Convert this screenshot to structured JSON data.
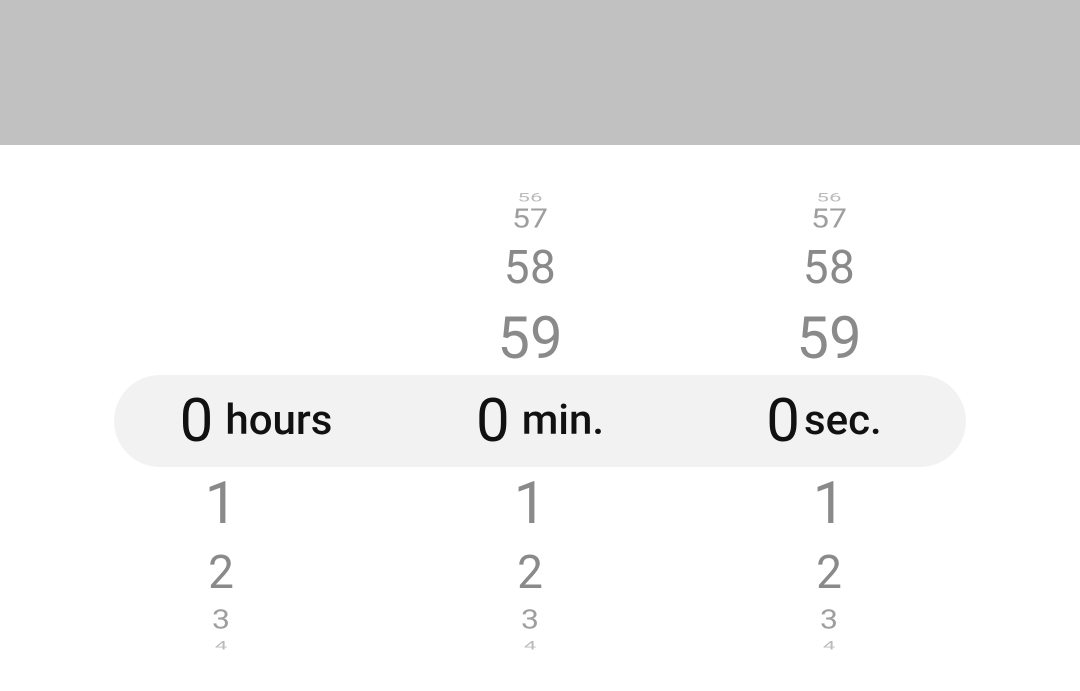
{
  "picker": {
    "hours": {
      "selected": "0",
      "label": "hours",
      "above": [],
      "below": [
        "1",
        "2",
        "3",
        "4"
      ]
    },
    "minutes": {
      "selected": "0",
      "label": "min.",
      "above": [
        "56",
        "57",
        "58",
        "59"
      ],
      "below": [
        "1",
        "2",
        "3",
        "4"
      ]
    },
    "seconds": {
      "selected": "0",
      "label": "sec.",
      "above": [
        "56",
        "57",
        "58",
        "59"
      ],
      "below": [
        "1",
        "2",
        "3",
        "4"
      ]
    }
  }
}
